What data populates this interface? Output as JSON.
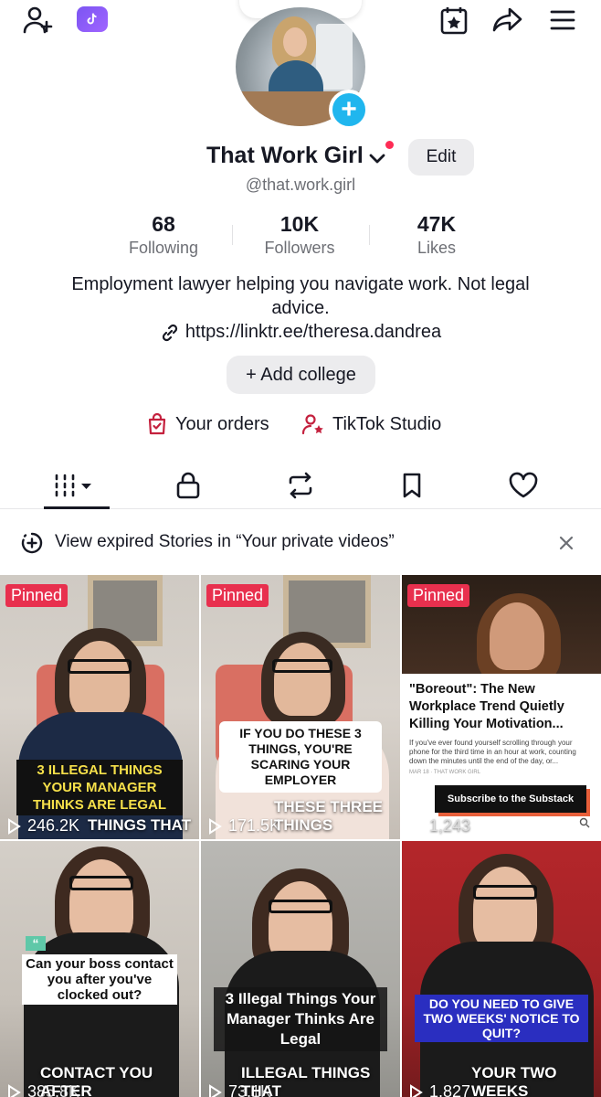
{
  "profile": {
    "display_name": "That Work Girl",
    "handle": "@that.work.girl",
    "edit_label": "Edit",
    "bio": "Employment lawyer helping you navigate work. Not legal advice.",
    "link": "https://linktr.ee/theresa.dandrea",
    "add_college_label": "+ Add college"
  },
  "stats": [
    {
      "value": "68",
      "label": "Following"
    },
    {
      "value": "10K",
      "label": "Followers"
    },
    {
      "value": "47K",
      "label": "Likes"
    }
  ],
  "quick_links": {
    "orders": "Your orders",
    "studio": "TikTok Studio"
  },
  "stories_banner": {
    "text": "View expired Stories in “Your private videos”"
  },
  "videos": [
    {
      "pinned": "Pinned",
      "caption": "3 ILLEGAL THINGS YOUR MANAGER THINKS ARE LEGAL",
      "views": "246.2K",
      "bottom": "THINGS THAT"
    },
    {
      "pinned": "Pinned",
      "caption": "IF YOU DO THESE 3 THINGS, YOU'RE SCARING YOUR EMPLOYER",
      "views": "171.5K",
      "bottom": "THESE THREE THINGS"
    },
    {
      "pinned": "Pinned",
      "article_title": "\"Boreout\": The New Workplace Trend Quietly Killing Your Motivation...",
      "article_body": "If you've ever found yourself scrolling through your phone for the third time in an hour at work, counting down the minutes until the end of the day, or...",
      "article_meta": "MAR 18 · THAT WORK GIRL",
      "subscribe": "Subscribe to the Substack",
      "views": "1,243"
    },
    {
      "caption": "Can your boss contact you after you've clocked out?",
      "views": "385.8K",
      "bottom": "CONTACT YOU AFTER"
    },
    {
      "caption": "3 Illegal Things Your Manager Thinks Are Legal",
      "views": "73.1K",
      "bottom": "ILLEGAL THINGS THAT"
    },
    {
      "caption": "DO YOU NEED TO GIVE TWO WEEKS' NOTICE TO QUIT?",
      "views": "1,827",
      "bottom": "YOUR TWO WEEKS"
    }
  ],
  "colors": {
    "accent_red": "#fe2c55",
    "plus_blue": "#20b6ee",
    "pinned_red": "#e8304e"
  }
}
